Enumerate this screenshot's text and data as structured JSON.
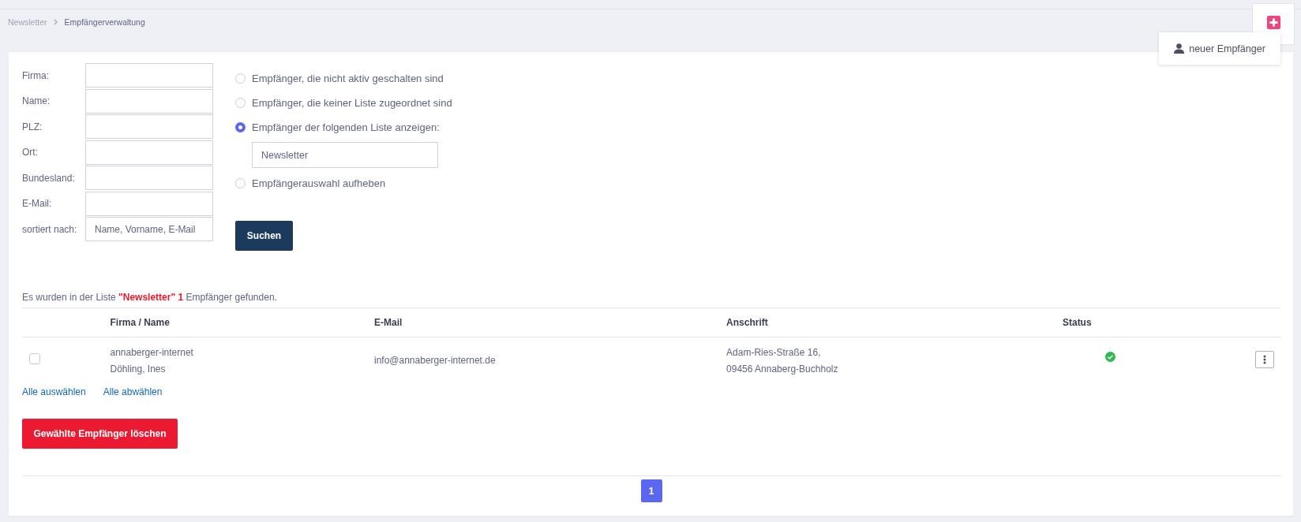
{
  "breadcrumb": [
    {
      "label": "Newsletter",
      "selected": false
    },
    {
      "label": "Empfängerverwaltung",
      "selected": true
    }
  ],
  "add_menu": {
    "item": "neuer Empfänger"
  },
  "filters": [
    {
      "label": "Firma:"
    },
    {
      "label": "Name:"
    },
    {
      "label": "PLZ:"
    },
    {
      "label": "Ort:"
    },
    {
      "label": "Bundesland:"
    },
    {
      "label": "E-Mail:"
    },
    {
      "label": "sortiert nach:",
      "value": "Name, Vorname, E-Mail"
    }
  ],
  "options": [
    {
      "label": "Empfänger, die nicht aktiv geschalten sind",
      "selected": false
    },
    {
      "label": "Empfänger, die keiner Liste zugeordnet sind",
      "selected": false
    },
    {
      "label": "Empfänger der folgenden Liste anzeigen:",
      "selected": true,
      "list_value": "Newsletter"
    },
    {
      "label": "Empfängerauswahl aufheben",
      "selected": false
    }
  ],
  "search_button": "Suchen",
  "result_text": "Es wurden in der Liste **\"Newsletter\" 1** Empfänger gefunden.",
  "table": {
    "columns": [
      "Firma / Name",
      "E-Mail",
      "Anschrift",
      "Status"
    ],
    "rows": [
      {
        "checked": false,
        "company": "annaberger-internet",
        "name": "Döhling, Ines",
        "email": "info@annaberger-internet.de",
        "address": [
          "Adam-Ries-Straße 16,",
          "09456 Annaberg-Buchholz"
        ],
        "active": true
      }
    ]
  },
  "select_all": "Alle auswählen",
  "deselect_all": "Alle abwählen",
  "delete_button": "Gewählte Empfänger löschen",
  "pagination": [
    {
      "label": "1",
      "selected": true
    }
  ]
}
